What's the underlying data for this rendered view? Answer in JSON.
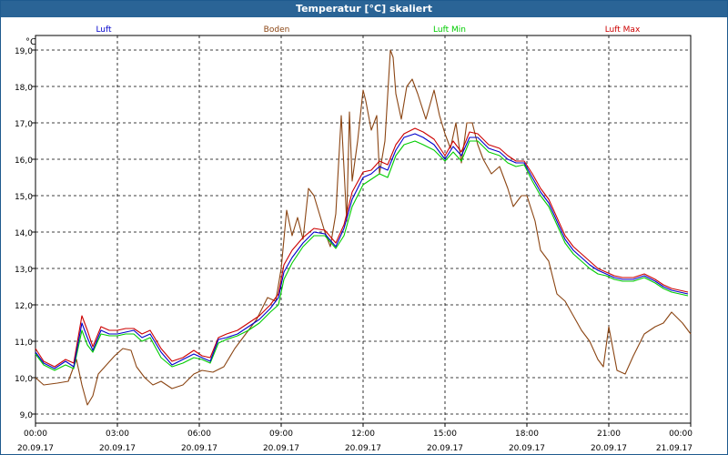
{
  "window": {
    "title": "Temperatur [°C] skaliert"
  },
  "chart_data": {
    "type": "line",
    "title": "Temperatur [°C] skaliert",
    "ylabel": "°C",
    "xlabel": "",
    "ylim": [
      8.75,
      19.4
    ],
    "yticks": [
      "9,0",
      "10,0",
      "11,0",
      "12,0",
      "13,0",
      "14,0",
      "15,0",
      "16,0",
      "17,0",
      "18,0",
      "19,0"
    ],
    "ytick_values": [
      9,
      10,
      11,
      12,
      13,
      14,
      15,
      16,
      17,
      18,
      19
    ],
    "xlim": [
      0,
      24
    ],
    "xticks": [
      {
        "h": 0,
        "time": "00:00",
        "date": "20.09.17"
      },
      {
        "h": 3,
        "time": "03:00",
        "date": "20.09.17"
      },
      {
        "h": 6,
        "time": "06:00",
        "date": "20.09.17"
      },
      {
        "h": 9,
        "time": "09:00",
        "date": "20.09.17"
      },
      {
        "h": 12,
        "time": "12:00",
        "date": "20.09.17"
      },
      {
        "h": 15,
        "time": "15:00",
        "date": "20.09.17"
      },
      {
        "h": 18,
        "time": "18:00",
        "date": "20.09.17"
      },
      {
        "h": 21,
        "time": "21:00",
        "date": "20.09.17"
      },
      {
        "h": 24,
        "time": "00:00",
        "date": "21.09.17"
      }
    ],
    "grid": true,
    "legend_placement": "top",
    "series": [
      {
        "name": "Luft",
        "color": "#0000cc",
        "x": [
          0,
          0.3,
          0.7,
          1.1,
          1.4,
          1.7,
          1.9,
          2.1,
          2.4,
          2.7,
          3.0,
          3.3,
          3.6,
          3.9,
          4.2,
          4.6,
          5.0,
          5.4,
          5.8,
          6.1,
          6.4,
          6.7,
          7.0,
          7.4,
          7.8,
          8.2,
          8.6,
          8.9,
          9.1,
          9.4,
          9.8,
          10.2,
          10.6,
          11.0,
          11.3,
          11.6,
          12.0,
          12.3,
          12.6,
          12.9,
          13.2,
          13.5,
          13.9,
          14.2,
          14.6,
          15.0,
          15.3,
          15.6,
          15.9,
          16.2,
          16.6,
          17.0,
          17.3,
          17.6,
          17.9,
          18.2,
          18.5,
          18.8,
          19.1,
          19.4,
          19.7,
          20.0,
          20.3,
          20.6,
          20.9,
          21.2,
          21.5,
          21.9,
          22.3,
          22.7,
          23.0,
          23.3,
          23.6,
          23.9
        ],
        "y": [
          10.7,
          10.4,
          10.25,
          10.45,
          10.3,
          11.5,
          11.1,
          10.75,
          11.3,
          11.2,
          11.2,
          11.25,
          11.3,
          11.1,
          11.2,
          10.7,
          10.35,
          10.5,
          10.65,
          10.55,
          10.45,
          11.05,
          11.1,
          11.2,
          11.4,
          11.6,
          11.9,
          12.2,
          12.9,
          13.3,
          13.7,
          14.0,
          13.95,
          13.6,
          14.1,
          14.9,
          15.5,
          15.6,
          15.8,
          15.7,
          16.25,
          16.6,
          16.7,
          16.6,
          16.4,
          16.0,
          16.35,
          16.1,
          16.6,
          16.6,
          16.3,
          16.2,
          16.0,
          15.9,
          15.9,
          15.5,
          15.1,
          14.8,
          14.3,
          13.8,
          13.5,
          13.3,
          13.1,
          12.95,
          12.85,
          12.75,
          12.7,
          12.7,
          12.8,
          12.65,
          12.5,
          12.4,
          12.35,
          12.3
        ]
      },
      {
        "name": "Boden",
        "color": "#8b4513",
        "x": [
          0,
          0.3,
          0.8,
          1.2,
          1.5,
          1.7,
          1.9,
          2.1,
          2.3,
          2.6,
          2.9,
          3.2,
          3.5,
          3.7,
          4.0,
          4.3,
          4.6,
          5.0,
          5.4,
          5.8,
          6.1,
          6.5,
          6.9,
          7.3,
          7.7,
          8.1,
          8.5,
          8.8,
          9.0,
          9.2,
          9.4,
          9.6,
          9.8,
          10.0,
          10.2,
          10.4,
          10.6,
          10.8,
          11.0,
          11.2,
          11.4,
          11.5,
          11.6,
          11.8,
          12.0,
          12.1,
          12.3,
          12.5,
          12.6,
          12.8,
          13.0,
          13.1,
          13.2,
          13.4,
          13.6,
          13.8,
          14.0,
          14.3,
          14.6,
          14.8,
          15.0,
          15.2,
          15.4,
          15.6,
          15.8,
          16.0,
          16.2,
          16.4,
          16.7,
          17.0,
          17.3,
          17.5,
          17.8,
          18.0,
          18.3,
          18.5,
          18.8,
          19.1,
          19.4,
          19.7,
          20.0,
          20.3,
          20.6,
          20.8,
          21.0,
          21.3,
          21.6,
          21.9,
          22.3,
          22.7,
          23.0,
          23.3,
          23.7,
          24.0
        ],
        "y": [
          10.0,
          9.8,
          9.85,
          9.9,
          10.5,
          9.8,
          9.25,
          9.5,
          10.1,
          10.35,
          10.6,
          10.8,
          10.75,
          10.3,
          10.0,
          9.8,
          9.9,
          9.7,
          9.8,
          10.1,
          10.2,
          10.15,
          10.3,
          10.8,
          11.2,
          11.6,
          12.2,
          12.1,
          13.0,
          14.6,
          13.9,
          14.4,
          13.8,
          15.2,
          15.0,
          14.5,
          14.0,
          13.6,
          14.5,
          17.2,
          14.3,
          17.3,
          15.4,
          16.5,
          17.9,
          17.6,
          16.8,
          17.2,
          15.6,
          16.5,
          19.0,
          18.8,
          17.8,
          17.1,
          18.0,
          18.2,
          17.8,
          17.1,
          17.9,
          17.2,
          16.7,
          16.3,
          17.0,
          15.9,
          17.0,
          17.0,
          16.4,
          16.0,
          15.6,
          15.8,
          15.2,
          14.7,
          15.0,
          15.0,
          14.3,
          13.5,
          13.2,
          12.3,
          12.1,
          11.7,
          11.3,
          11.0,
          10.5,
          10.3,
          11.4,
          10.2,
          10.1,
          10.6,
          11.2,
          11.4,
          11.5,
          11.8,
          11.5,
          11.2
        ]
      },
      {
        "name": "Luft Min",
        "color": "#00cc00",
        "x": [
          0,
          0.3,
          0.7,
          1.1,
          1.4,
          1.7,
          1.9,
          2.1,
          2.4,
          2.7,
          3.0,
          3.3,
          3.6,
          3.9,
          4.2,
          4.6,
          5.0,
          5.4,
          5.8,
          6.1,
          6.4,
          6.7,
          7.0,
          7.4,
          7.8,
          8.2,
          8.6,
          8.9,
          9.1,
          9.4,
          9.8,
          10.2,
          10.6,
          11.0,
          11.3,
          11.6,
          12.0,
          12.3,
          12.6,
          12.9,
          13.2,
          13.5,
          13.9,
          14.2,
          14.6,
          15.0,
          15.3,
          15.6,
          15.9,
          16.2,
          16.6,
          17.0,
          17.3,
          17.6,
          17.9,
          18.2,
          18.5,
          18.8,
          19.1,
          19.4,
          19.7,
          20.0,
          20.3,
          20.6,
          20.9,
          21.2,
          21.5,
          21.9,
          22.3,
          22.7,
          23.0,
          23.3,
          23.6,
          23.9
        ],
        "y": [
          10.65,
          10.35,
          10.2,
          10.35,
          10.25,
          11.3,
          10.9,
          10.7,
          11.2,
          11.15,
          11.15,
          11.2,
          11.2,
          11.0,
          11.1,
          10.55,
          10.3,
          10.4,
          10.55,
          10.5,
          10.4,
          10.95,
          11.05,
          11.15,
          11.3,
          11.5,
          11.8,
          12.0,
          12.7,
          13.15,
          13.6,
          13.9,
          13.9,
          13.55,
          13.9,
          14.7,
          15.3,
          15.45,
          15.6,
          15.5,
          16.1,
          16.4,
          16.5,
          16.4,
          16.25,
          15.95,
          16.2,
          15.95,
          16.5,
          16.5,
          16.2,
          16.1,
          15.9,
          15.8,
          15.85,
          15.4,
          15.0,
          14.7,
          14.2,
          13.7,
          13.4,
          13.2,
          13.0,
          12.85,
          12.8,
          12.7,
          12.65,
          12.65,
          12.75,
          12.6,
          12.45,
          12.35,
          12.3,
          12.25
        ]
      },
      {
        "name": "Luft Max",
        "color": "#cc0000",
        "x": [
          0,
          0.3,
          0.7,
          1.1,
          1.4,
          1.7,
          1.9,
          2.1,
          2.4,
          2.7,
          3.0,
          3.3,
          3.6,
          3.9,
          4.2,
          4.6,
          5.0,
          5.4,
          5.8,
          6.1,
          6.4,
          6.7,
          7.0,
          7.4,
          7.8,
          8.2,
          8.6,
          8.9,
          9.1,
          9.4,
          9.8,
          10.2,
          10.6,
          11.0,
          11.3,
          11.6,
          12.0,
          12.3,
          12.6,
          12.9,
          13.2,
          13.5,
          13.9,
          14.2,
          14.6,
          15.0,
          15.3,
          15.6,
          15.9,
          16.2,
          16.6,
          17.0,
          17.3,
          17.6,
          17.9,
          18.2,
          18.5,
          18.8,
          19.1,
          19.4,
          19.7,
          20.0,
          20.3,
          20.6,
          20.9,
          21.2,
          21.5,
          21.9,
          22.3,
          22.7,
          23.0,
          23.3,
          23.6,
          23.9
        ],
        "y": [
          10.8,
          10.45,
          10.3,
          10.5,
          10.4,
          11.7,
          11.3,
          10.85,
          11.4,
          11.3,
          11.3,
          11.35,
          11.35,
          11.2,
          11.3,
          10.8,
          10.45,
          10.55,
          10.75,
          10.6,
          10.55,
          11.1,
          11.2,
          11.3,
          11.5,
          11.7,
          12.0,
          12.3,
          13.1,
          13.5,
          13.85,
          14.1,
          14.05,
          13.7,
          14.2,
          15.1,
          15.65,
          15.7,
          15.95,
          15.85,
          16.4,
          16.7,
          16.85,
          16.75,
          16.55,
          16.1,
          16.5,
          16.2,
          16.75,
          16.7,
          16.4,
          16.3,
          16.1,
          15.95,
          15.95,
          15.6,
          15.2,
          14.9,
          14.4,
          13.9,
          13.6,
          13.4,
          13.2,
          13.0,
          12.9,
          12.8,
          12.75,
          12.75,
          12.85,
          12.7,
          12.55,
          12.45,
          12.4,
          12.35
        ]
      }
    ]
  }
}
